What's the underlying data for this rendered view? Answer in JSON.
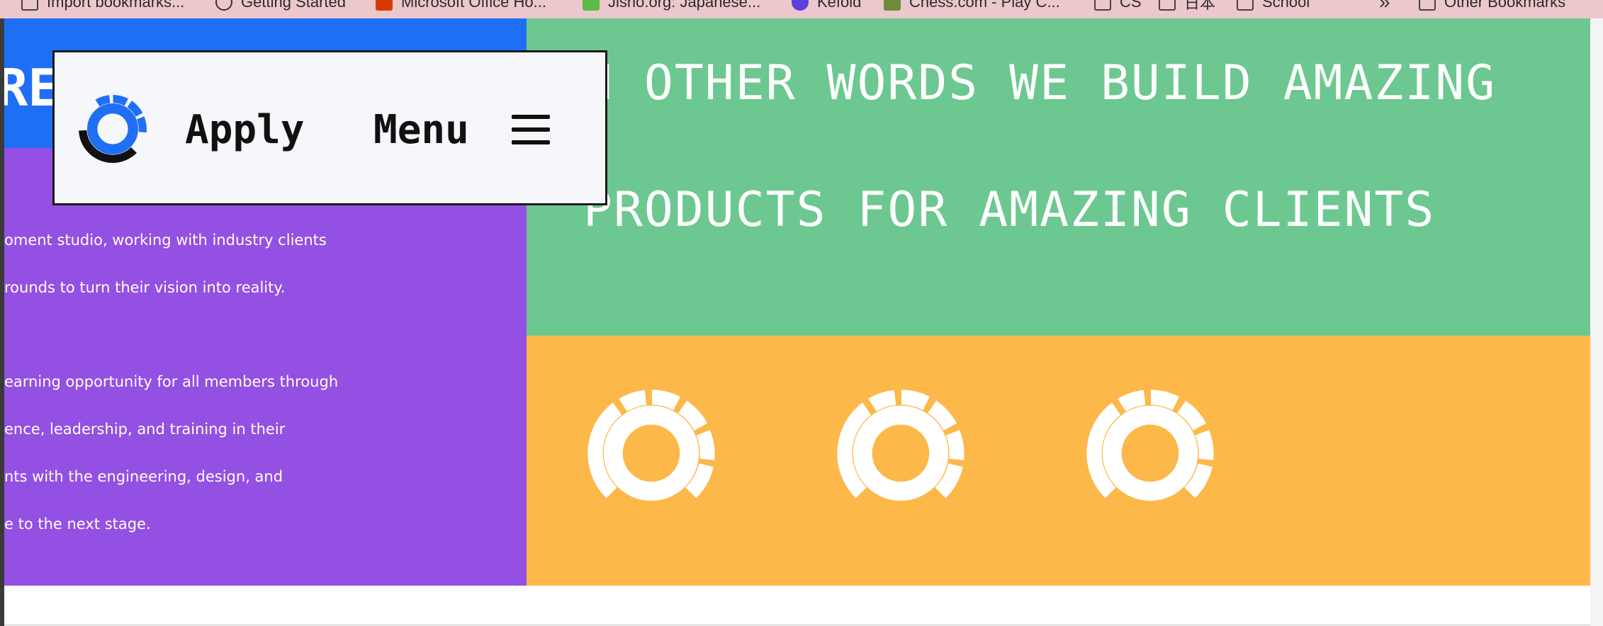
{
  "bookmarks": [
    {
      "label": "Import bookmarks...",
      "icon": "folder-icon"
    },
    {
      "label": "Getting Started",
      "icon": "globe-icon"
    },
    {
      "label": "Microsoft Office Ho...",
      "icon": "office-icon"
    },
    {
      "label": "Jisho.org: Japanese...",
      "icon": "jisho-icon"
    },
    {
      "label": "Kefold",
      "icon": "kefold-icon"
    },
    {
      "label": "Chess.com - Play C...",
      "icon": "chess-icon"
    },
    {
      "label": "CS",
      "icon": "folder-icon"
    },
    {
      "label": "日本",
      "icon": "folder-icon"
    },
    {
      "label": "School",
      "icon": "folder-icon"
    },
    {
      "label": "»",
      "icon": "chevron-right-icon"
    },
    {
      "label": "Other Bookmarks",
      "icon": "folder-icon"
    }
  ],
  "nav": {
    "apply_label": "Apply",
    "menu_label": "Menu",
    "logo_icon": "studio-logo-icon",
    "menu_icon": "hamburger-icon"
  },
  "hero": {
    "heading_fragment": "RE",
    "about_lines": [
      "oment studio, working with industry clients",
      "rounds to turn their vision into reality.",
      "earning opportunity for all members through",
      "ence, leadership, and training in their",
      "nts with the engineering, design, and",
      "e to the next stage."
    ]
  },
  "tagline": {
    "line1": "N OTHER WORDS WE BUILD AMAZING",
    "line2": "PRODUCTS FOR AMAZING CLIENTS"
  },
  "colors": {
    "blue": "#1f6ff5",
    "purple": "#9450e2",
    "green": "#6cc890",
    "orange": "#fdb84a",
    "navbar": "#f6f7fa"
  },
  "logos": [
    "studio-logo-icon",
    "studio-logo-icon",
    "studio-logo-icon"
  ]
}
